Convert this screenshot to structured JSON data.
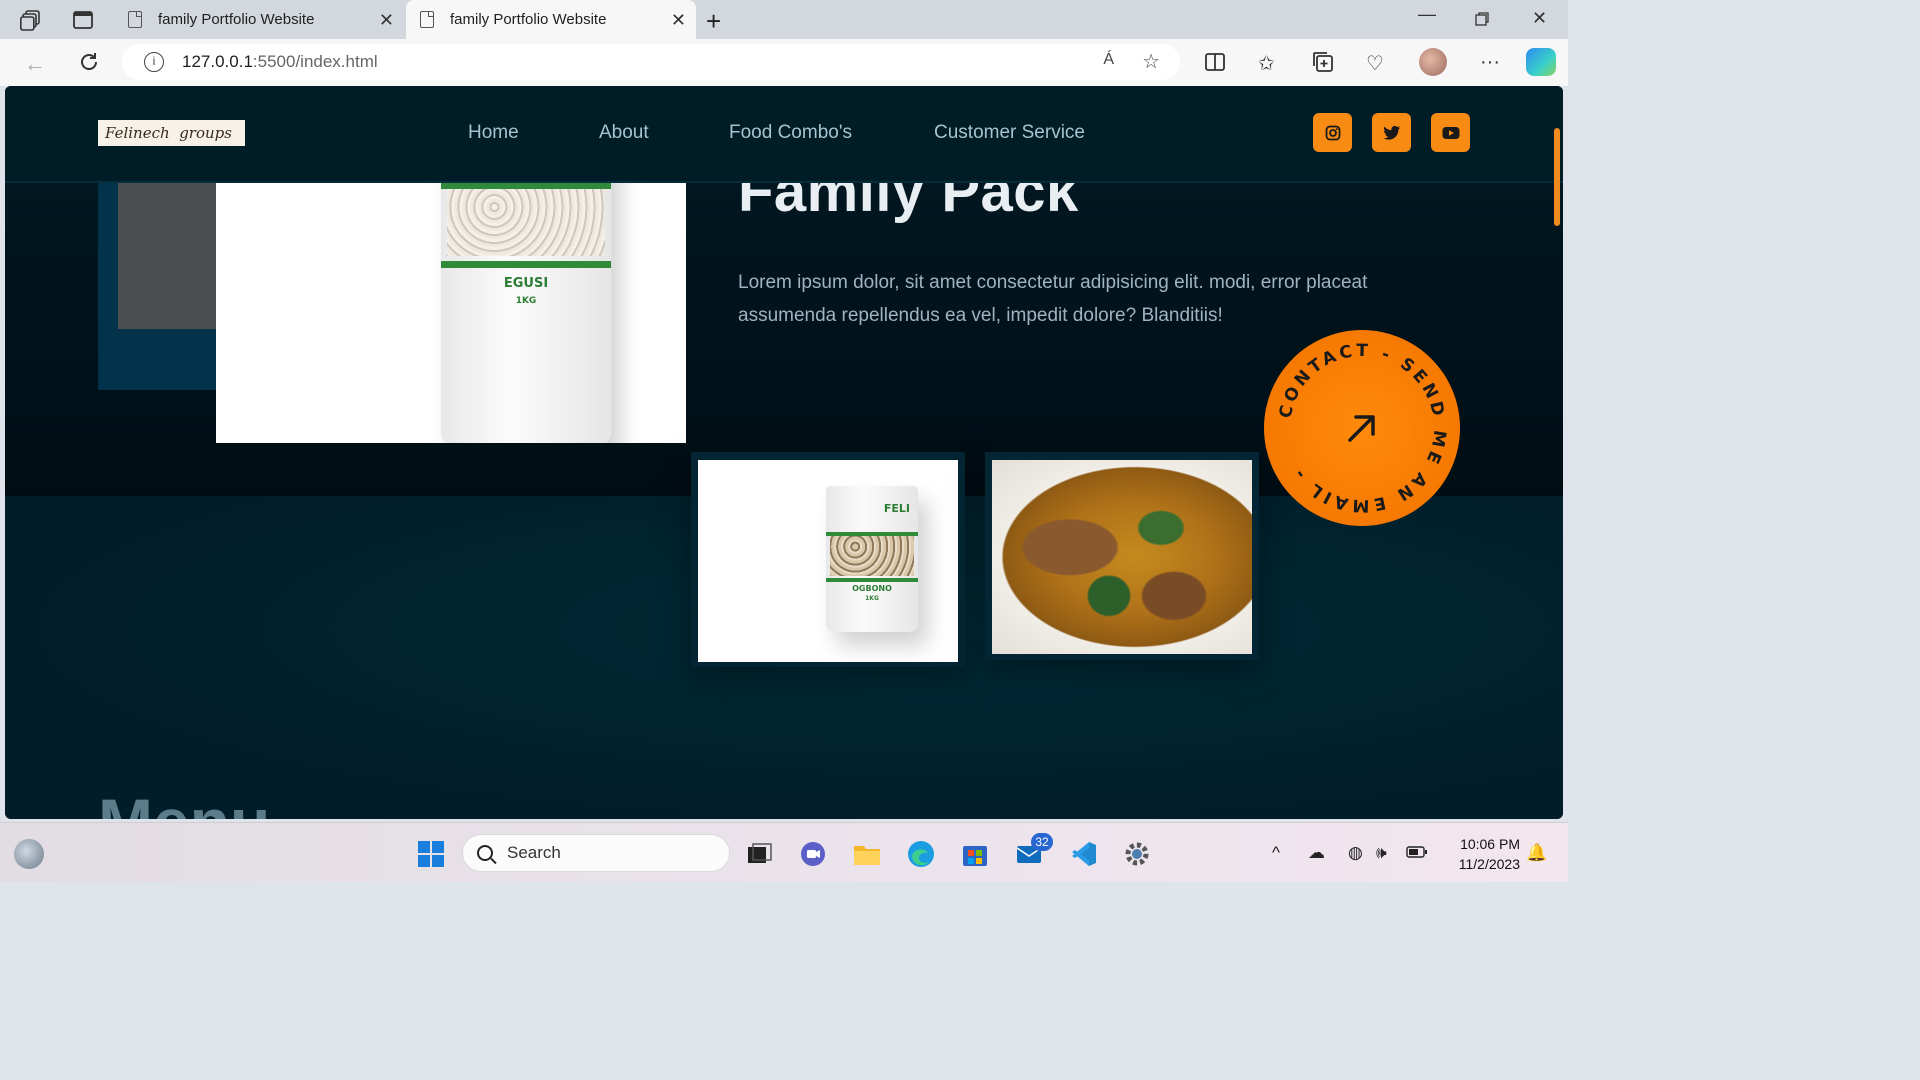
{
  "browser": {
    "tabs": [
      {
        "title": "family Portfolio Website"
      },
      {
        "title": "family Portfolio Website"
      }
    ],
    "url_host": "127.0.0.1",
    "url_path": ":5500/index.html",
    "read_aloud_label": "Á"
  },
  "site": {
    "logo_text": "Felinech  groups",
    "nav": [
      "Home",
      "About",
      "Food Combo's",
      "Customer Service"
    ],
    "social": [
      "instagram-icon",
      "twitter-icon",
      "youtube-icon"
    ],
    "accent_color": "#f88b13",
    "hero": {
      "title": "Family Pack",
      "text": "Lorem ipsum dolor, sit amet consectetur adipisicing elit. modi, error placeat assumenda repellendus ea vel, impedit dolore? Blanditiis!",
      "image_label": "EGUSI",
      "image_sub": "1KG"
    },
    "thumb1": {
      "brand": "FELI",
      "label": "OGBONO",
      "sub": "1KG"
    },
    "contact_badge": "CONTACT - SEND ME AN EMAIL - ",
    "section_title": "Menu"
  },
  "taskbar": {
    "search_placeholder": "Search",
    "mail_badge": "32",
    "time": "10:06 PM",
    "date": "11/2/2023"
  }
}
